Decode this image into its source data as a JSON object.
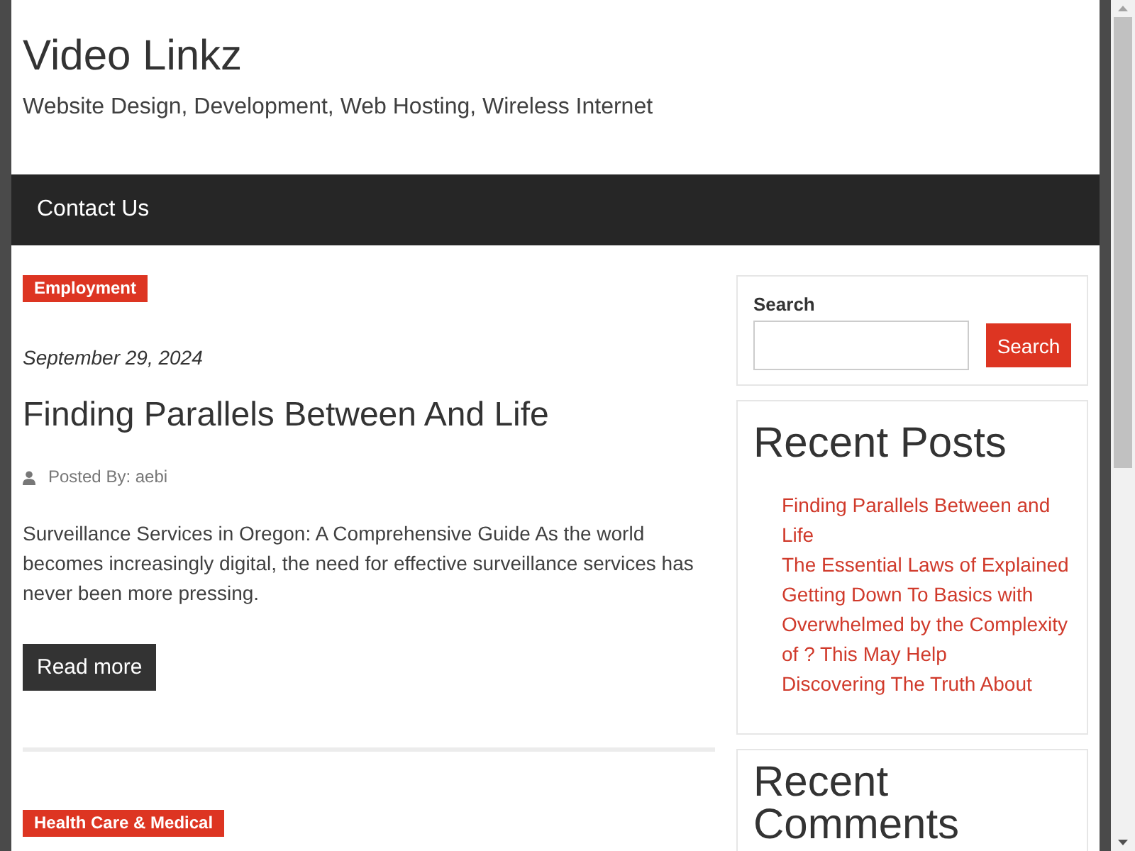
{
  "site": {
    "title": "Video Linkz",
    "tagline": "Website Design, Development, Web Hosting, Wireless Internet"
  },
  "nav": {
    "items": [
      {
        "label": "Contact Us"
      }
    ]
  },
  "posts": [
    {
      "category": "Employment",
      "date": "September 29, 2024",
      "title": "Finding Parallels Between And Life",
      "author": "Posted By: aebi",
      "excerpt": "Surveillance Services in Oregon: A Comprehensive Guide As the world becomes increasingly digital, the need for effective surveillance services has never been more pressing.",
      "button": "Read more"
    },
    {
      "category": "Health Care & Medical"
    }
  ],
  "sidebar": {
    "search": {
      "label": "Search",
      "button": "Search"
    },
    "widgets": [
      {
        "title": "Recent Posts",
        "links": [
          "Finding Parallels Between and Life",
          "The Essential Laws of Explained",
          "Getting Down To Basics with",
          "Overwhelmed by the Complexity of ? This May Help",
          "Discovering The Truth About"
        ]
      },
      {
        "title": "Recent Comments"
      }
    ]
  }
}
